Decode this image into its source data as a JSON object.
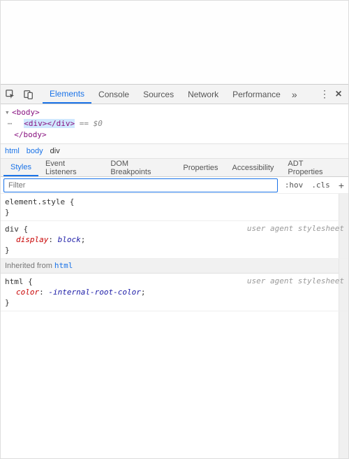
{
  "toolbar": {
    "tabs": [
      "Elements",
      "Console",
      "Sources",
      "Network",
      "Performance"
    ],
    "active_tab_index": 0,
    "overflow_glyph": "»",
    "menu_glyph": "⋮",
    "close_glyph": "×"
  },
  "dom_tree": {
    "line_body_open": "<body>",
    "selected_div": "<div></div>",
    "selected_suffix": " == $0",
    "line_body_close": "</body>"
  },
  "breadcrumbs": [
    "html",
    "body",
    "div"
  ],
  "styles_tabs": {
    "tabs": [
      "Styles",
      "Event Listeners",
      "DOM Breakpoints",
      "Properties",
      "Accessibility",
      "ADT Properties"
    ],
    "active_index": 0
  },
  "filter": {
    "placeholder": "Filter",
    "hov_label": ":hov",
    "cls_label": ".cls",
    "plus_glyph": "+"
  },
  "rules": {
    "element_style": {
      "selector": "element.style",
      "open": " {",
      "close": "}"
    },
    "div_rule": {
      "selector": "div",
      "open": " {",
      "prop": "display",
      "val": "block",
      "semi": ";",
      "close": "}",
      "note": "user agent stylesheet"
    },
    "inherited_header_prefix": "Inherited from ",
    "inherited_from_el": "html",
    "html_rule": {
      "selector": "html",
      "open": " {",
      "prop": "color",
      "val": "-internal-root-color",
      "semi": ";",
      "close": "}",
      "note": "user agent stylesheet"
    }
  }
}
